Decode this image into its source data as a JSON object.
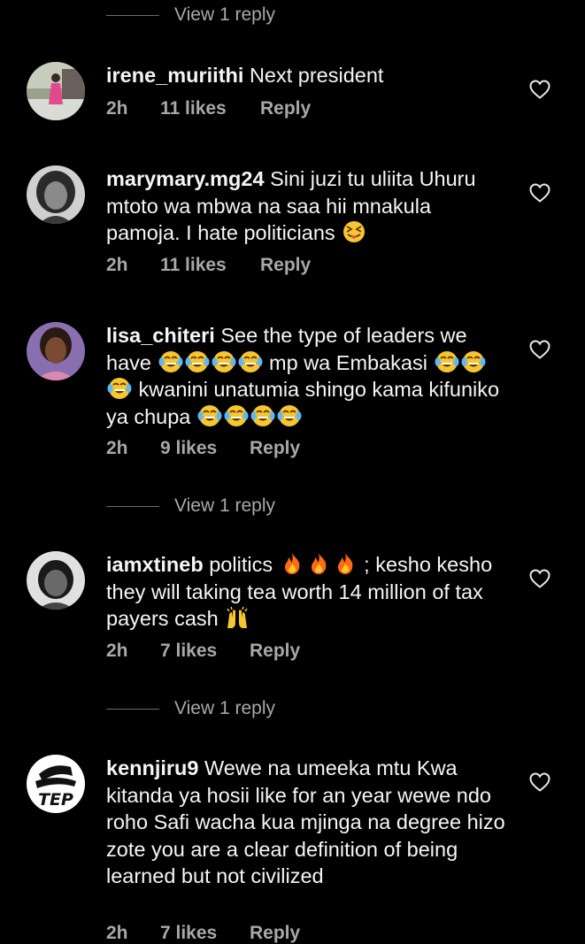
{
  "view_reply_label": "View 1 reply",
  "comments": [
    {
      "username": "irene_muriithi",
      "text": "Next president",
      "time": "2h",
      "likes": "11 likes",
      "reply": "Reply"
    },
    {
      "username": "marymary.mg24",
      "text": "Sini juzi tu uliita Uhuru mtoto wa mbwa na saa hii mnakula pamoja. I hate politicians",
      "emoji": "squinting-tongue-emoji",
      "time": "2h",
      "likes": "11 likes",
      "reply": "Reply"
    },
    {
      "username": "lisa_chiteri",
      "text1": "See the type of leaders we have",
      "text2": "mp wa Embakasi",
      "text3": "kwanini unatumia shingo kama kifuniko ya chupa",
      "emoji": "tears-of-joy-emoji",
      "time": "2h",
      "likes": "9 likes",
      "reply": "Reply"
    },
    {
      "username": "iamxtineb",
      "text1": "politics",
      "text2": "; kesho kesho they will taking tea worth 14 million of tax payers cash",
      "emoji1": "fire-emoji",
      "emoji2": "raising-hands-emoji",
      "time": "2h",
      "likes": "7 likes",
      "reply": "Reply"
    },
    {
      "username": "kennjiru9",
      "text": "Wewe na umeeka mtu Kwa kitanda ya hosii like for an year wewe ndo roho Safi wacha kua mjinga na degree hizo zote you are a clear definition of being learned but not civilized",
      "time": "2h",
      "likes": "7 likes",
      "reply": "Reply"
    }
  ],
  "colors": {
    "background": "#000000",
    "text": "#f5f5f5",
    "secondary": "#a8a8a8"
  }
}
